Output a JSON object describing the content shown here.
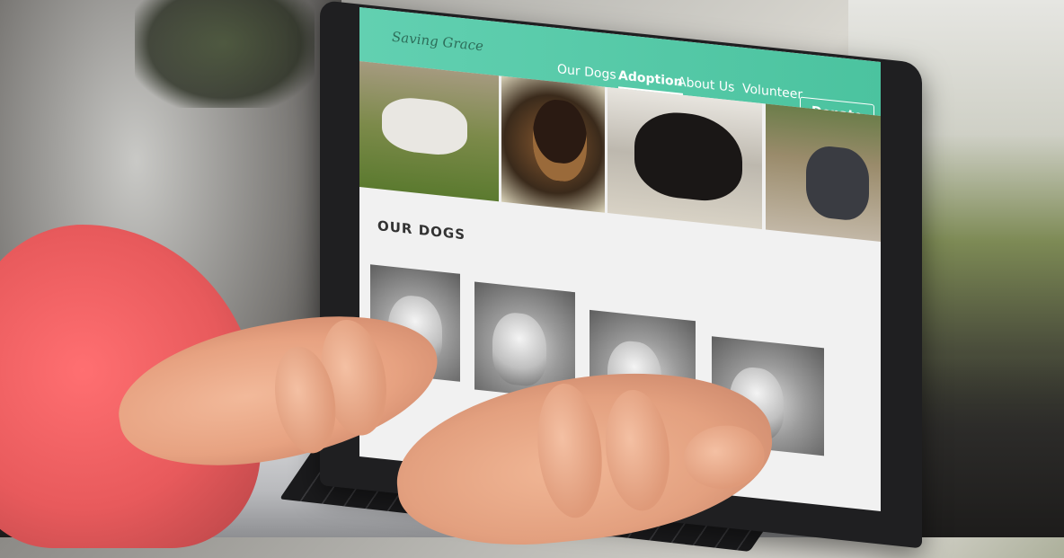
{
  "site": {
    "brand": "Saving Grace",
    "nav": [
      "Our Dogs",
      "Adoption",
      "About Us",
      "Volunteer"
    ],
    "active_nav": "Adoption",
    "donate_label": "Donate",
    "section_title": "OUR DOGS"
  },
  "colors": {
    "nav_bg": "#55c9a8",
    "nav_text": "#ffffff",
    "page_bg": "#f1f1f1",
    "sleeve": "#e85a5c"
  },
  "icons": [
    "laptop-icon"
  ]
}
